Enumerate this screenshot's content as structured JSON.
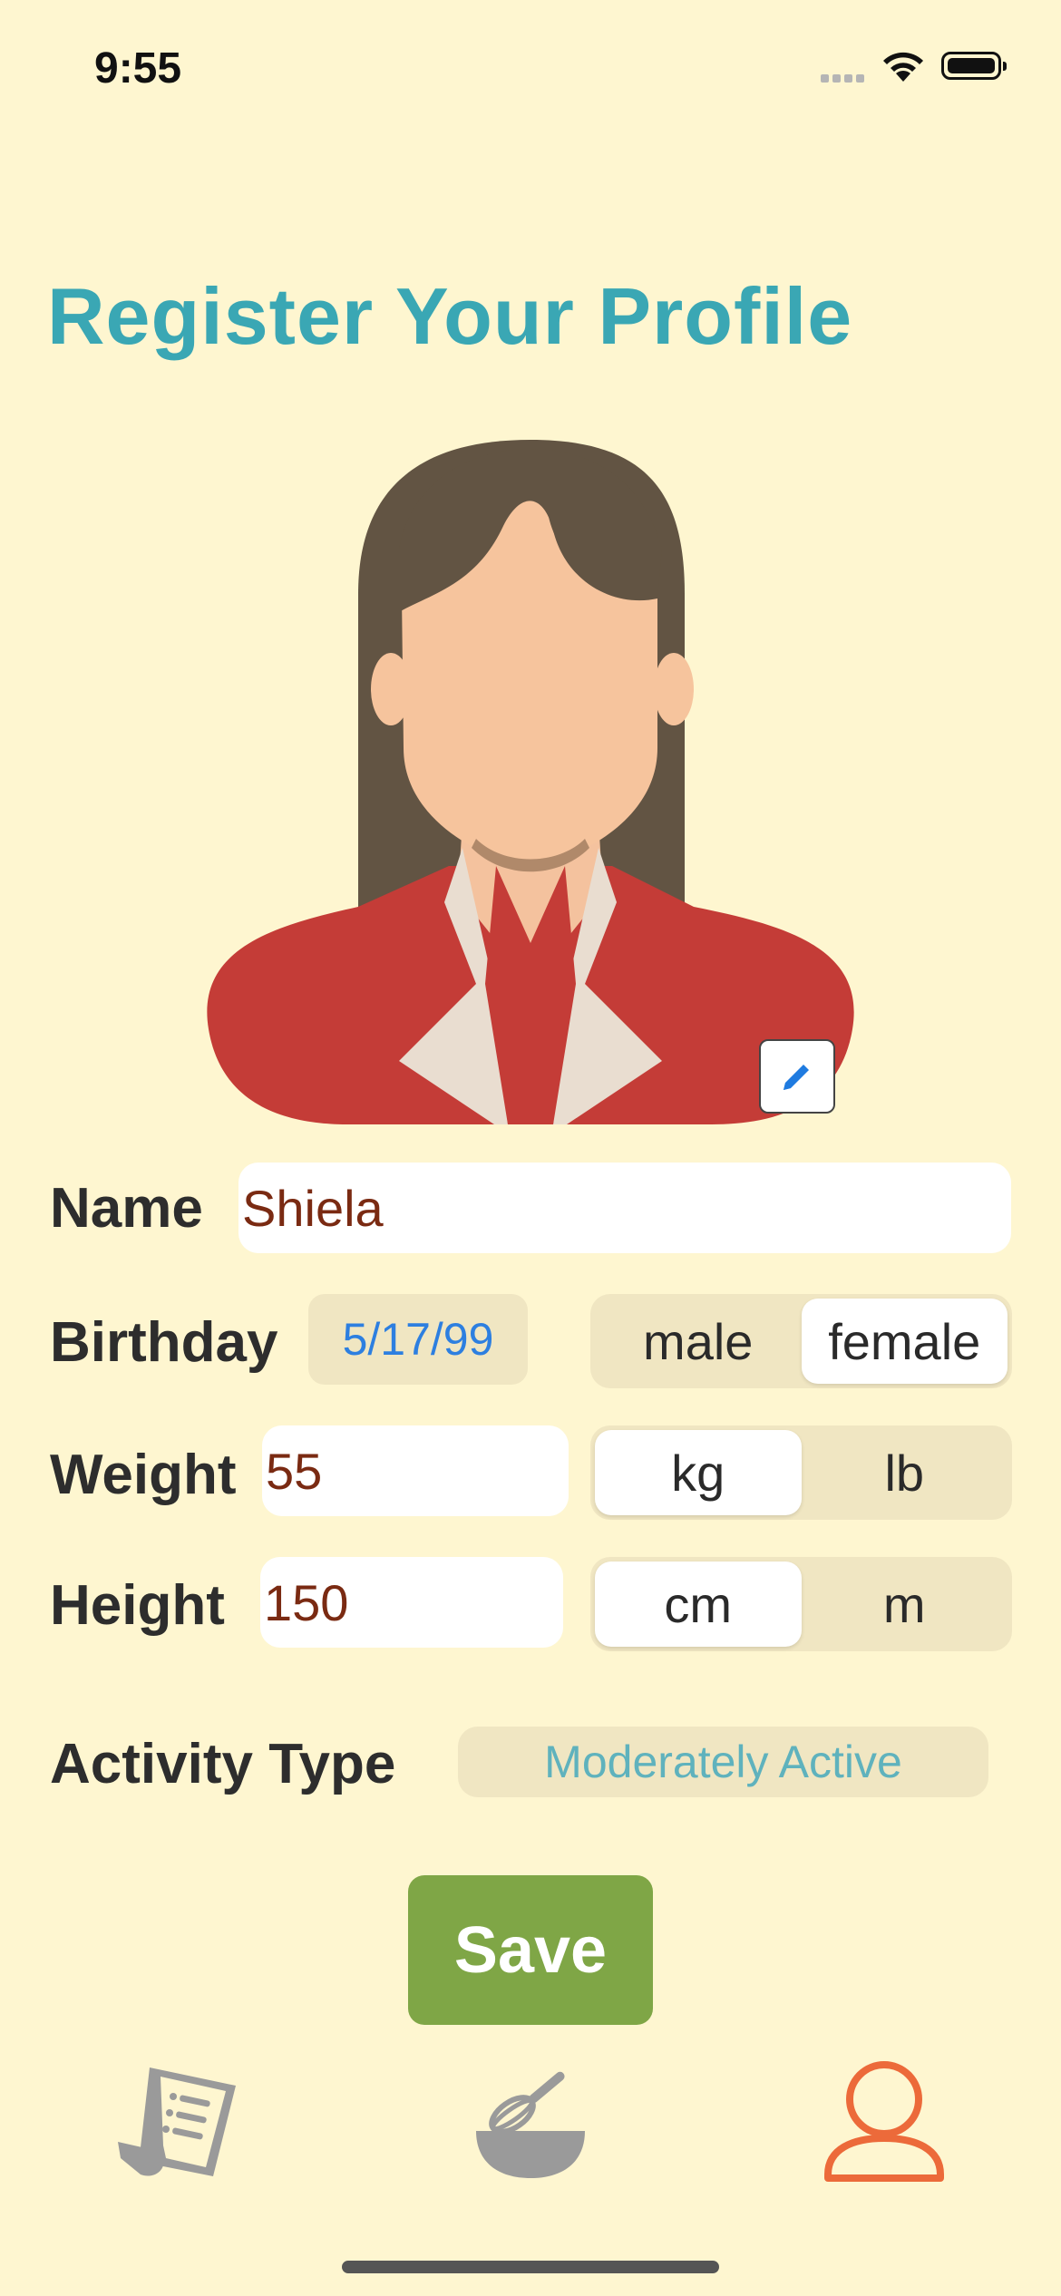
{
  "status_bar": {
    "time": "9:55"
  },
  "page": {
    "title": "Register Your Profile"
  },
  "form": {
    "name_label": "Name",
    "name_value": "Shiela",
    "birthday_label": "Birthday",
    "birthday_value": "5/17/99",
    "gender_options": [
      "male",
      "female"
    ],
    "gender_selected": "female",
    "weight_label": "Weight",
    "weight_value": "55",
    "weight_units": [
      "kg",
      "lb"
    ],
    "weight_unit_selected": "kg",
    "height_label": "Height",
    "height_value": "150",
    "height_units": [
      "cm",
      "m"
    ],
    "height_unit_selected": "cm",
    "activity_label": "Activity Type",
    "activity_value": "Moderately Active",
    "save_label": "Save"
  },
  "tab_bar": {
    "items": [
      {
        "icon": "recipe-list-icon",
        "active": false
      },
      {
        "icon": "whisk-bowl-icon",
        "active": false
      },
      {
        "icon": "profile-icon",
        "active": true
      }
    ]
  },
  "colors": {
    "background": "#fef6d0",
    "title": "#3aa7b4",
    "save": "#7fa646",
    "tab_active": "#ec6a3a",
    "tab_inactive": "#9a9a9a",
    "input_text": "#7a2a12"
  }
}
